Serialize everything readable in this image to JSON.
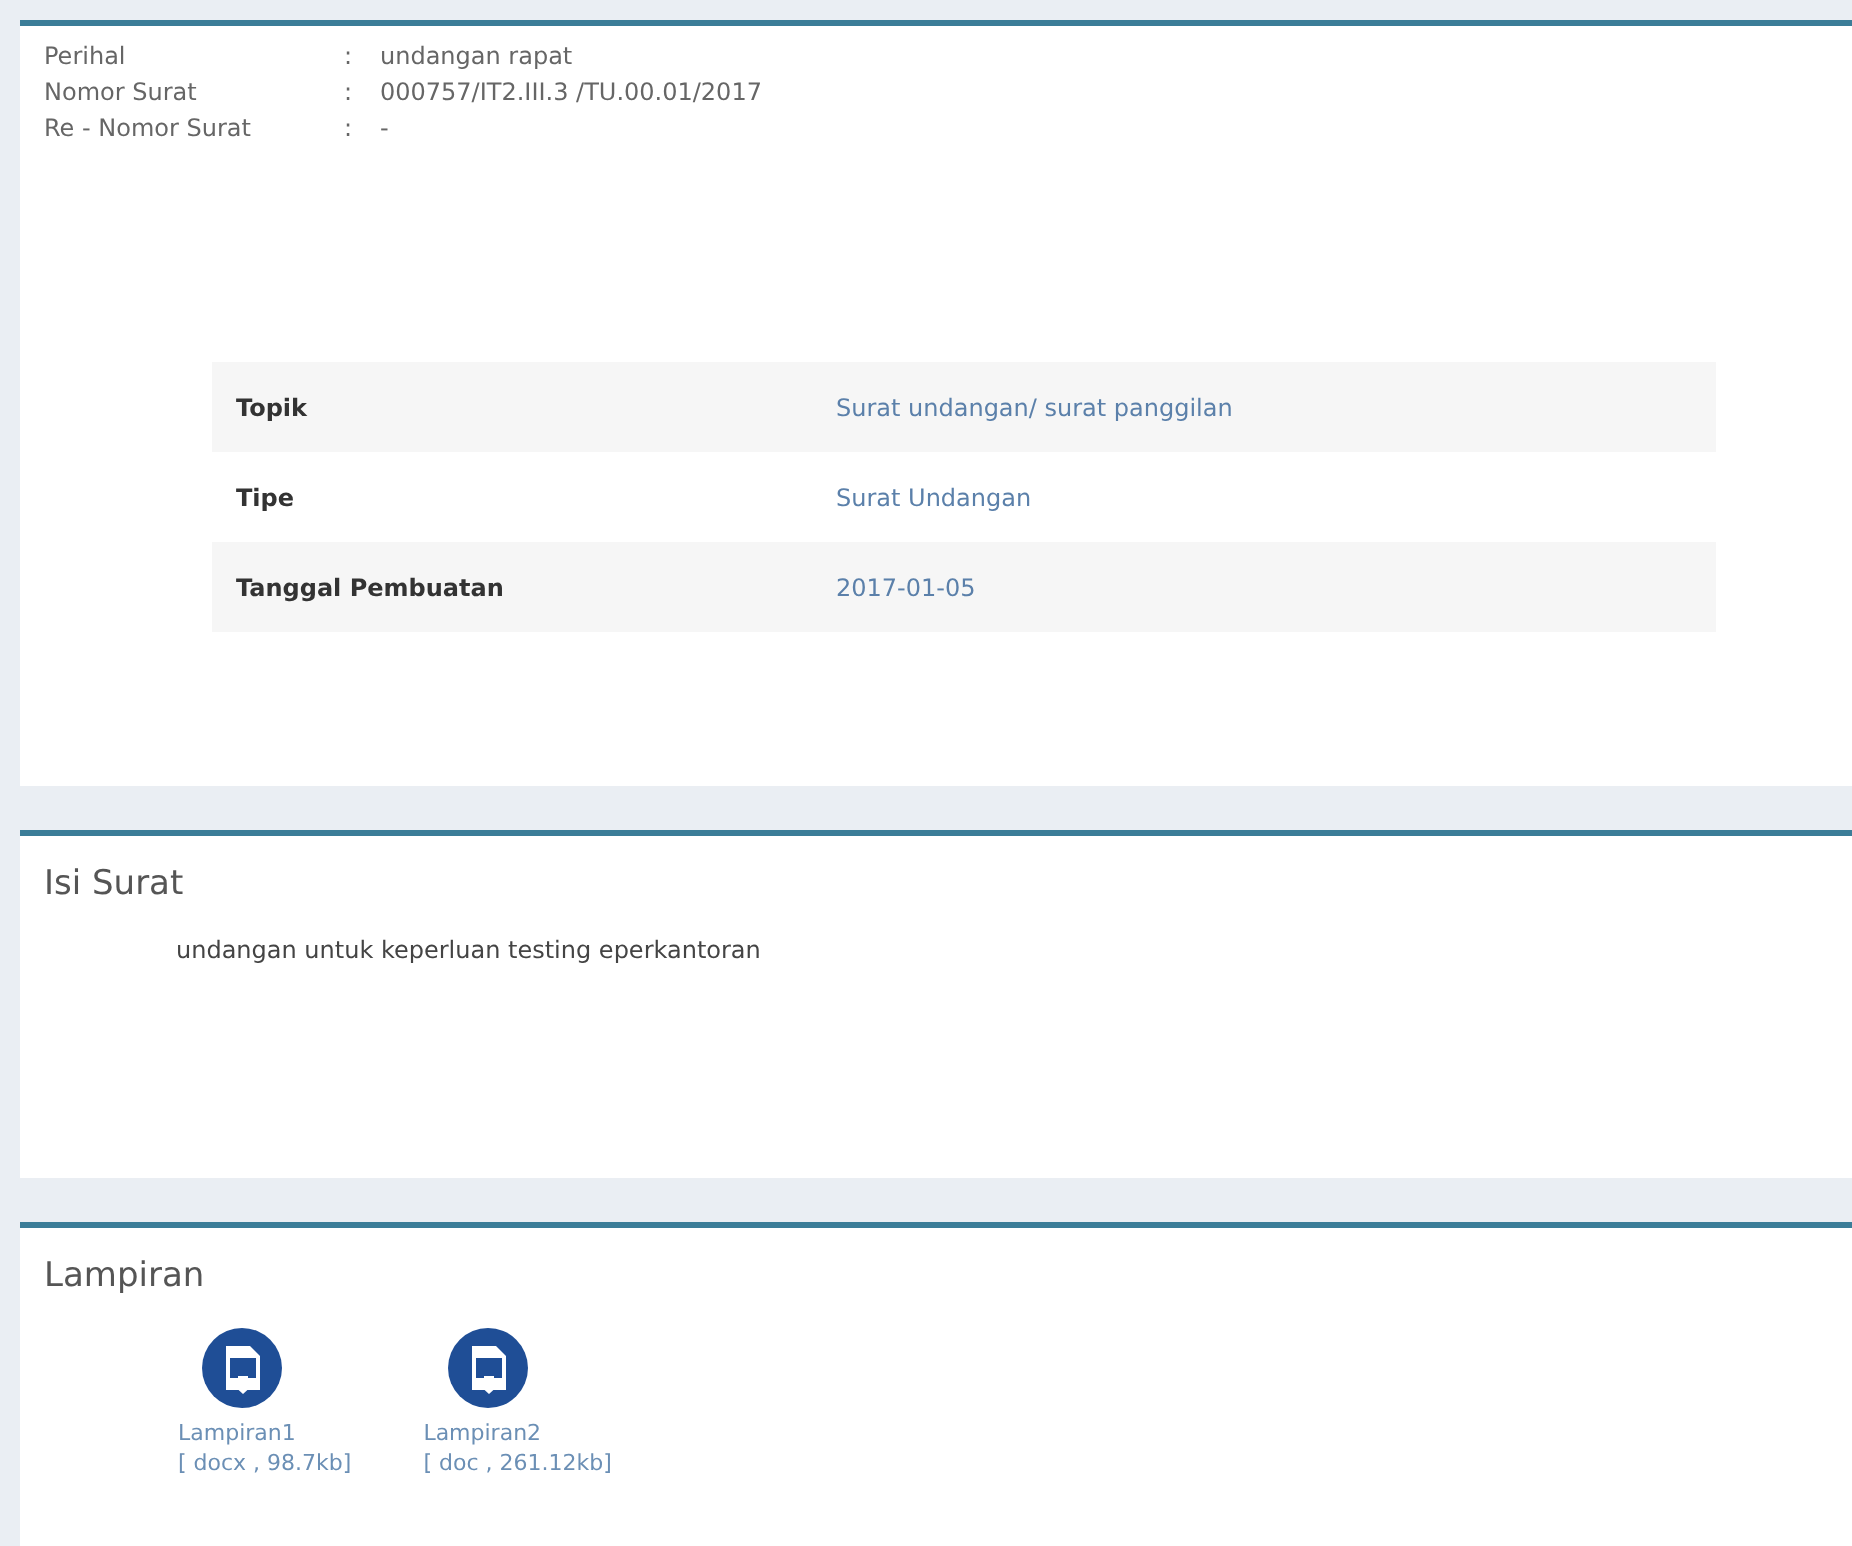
{
  "info": [
    {
      "label": "Perihal",
      "value": "undangan rapat"
    },
    {
      "label": "Nomor Surat",
      "value": "000757/IT2.III.3 /TU.00.01/2017"
    },
    {
      "label": "Re - Nomor Surat",
      "value": "-"
    }
  ],
  "separator": ":",
  "details": [
    {
      "label": "Topik",
      "value": "Surat undangan/ surat panggilan"
    },
    {
      "label": "Tipe",
      "value": "Surat Undangan"
    },
    {
      "label": "Tanggal Pembuatan",
      "value": "2017-01-05"
    }
  ],
  "isi": {
    "title": "Isi Surat",
    "body": "undangan untuk keperluan testing eperkantoran"
  },
  "lampiran": {
    "title": "Lampiran",
    "files": [
      {
        "name": "Lampiran1",
        "meta": "[ docx , 98.7kb]"
      },
      {
        "name": "Lampiran2",
        "meta": "[ doc , 261.12kb]"
      }
    ]
  }
}
